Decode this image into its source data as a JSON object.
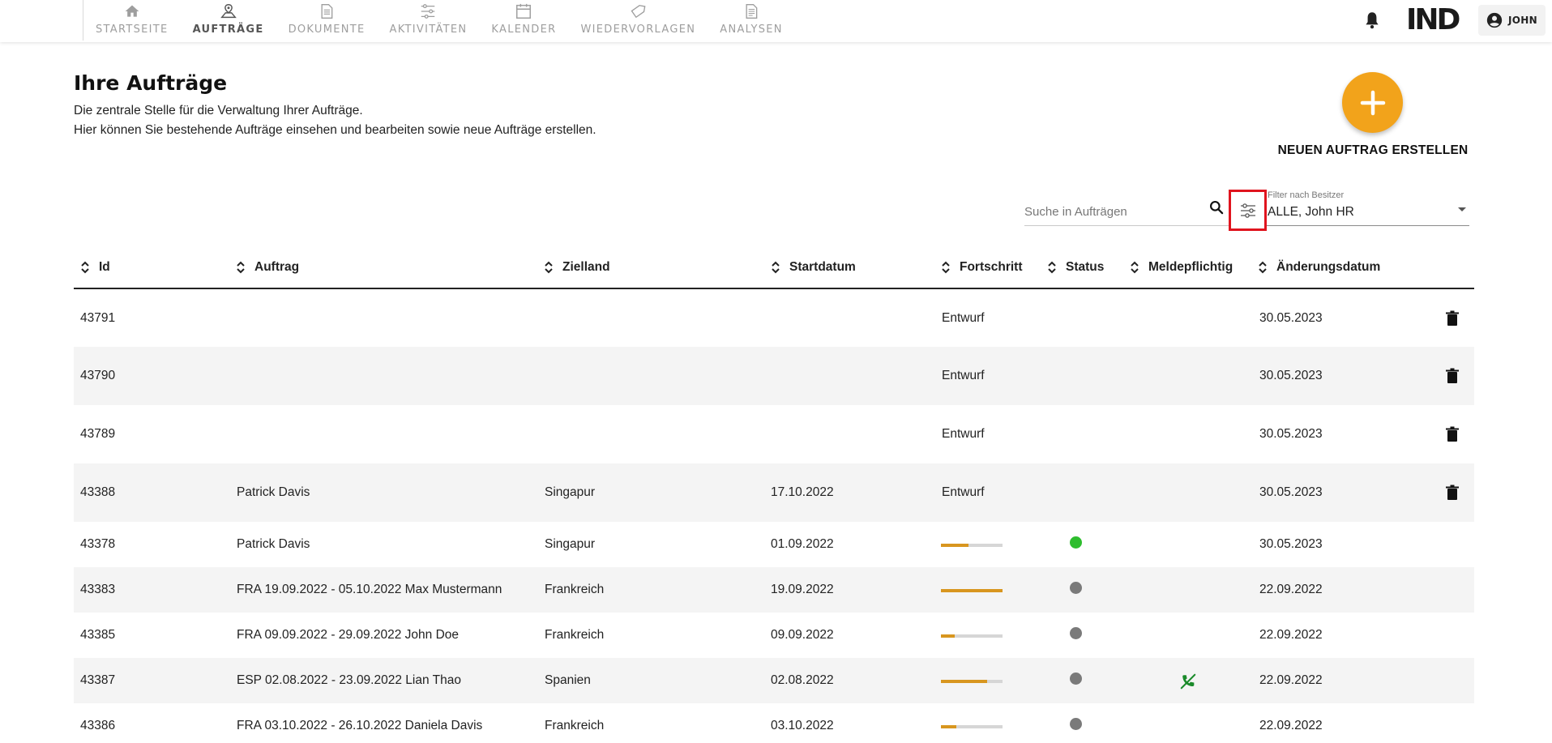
{
  "nav": {
    "items": [
      {
        "label": "STARTSEITE",
        "icon": "home-icon",
        "active": false
      },
      {
        "label": "AUFTRÄGE",
        "icon": "map-pin-icon",
        "active": true
      },
      {
        "label": "DOKUMENTE",
        "icon": "document-icon",
        "active": false
      },
      {
        "label": "AKTIVITÄTEN",
        "icon": "sliders-icon",
        "active": false
      },
      {
        "label": "KALENDER",
        "icon": "calendar-icon",
        "active": false
      },
      {
        "label": "WIEDERVORLAGEN",
        "icon": "tag-icon",
        "active": false
      },
      {
        "label": "ANALYSEN",
        "icon": "report-icon",
        "active": false
      }
    ]
  },
  "header": {
    "logo": "IND",
    "user_label": "JOHN"
  },
  "page": {
    "title": "Ihre Aufträge",
    "subtitle_line1": "Die zentrale Stelle für die Verwaltung Ihrer Aufträge.",
    "subtitle_line2": "Hier können Sie bestehende Aufträge einsehen und bearbeiten sowie neue Aufträge erstellen.",
    "new_order_label": "NEUEN AUFTRAG ERSTELLEN"
  },
  "toolbar": {
    "search_placeholder": "Suche in Aufträgen",
    "owner_filter_caption": "Filter nach Besitzer",
    "owner_filter_value": "ALLE, John HR"
  },
  "table": {
    "columns": [
      "Id",
      "Auftrag",
      "Zielland",
      "Startdatum",
      "Fortschritt",
      "Status",
      "Meldepflichtig",
      "Änderungsdatum"
    ],
    "rows": [
      {
        "id": "43791",
        "auftrag": "",
        "zielland": "",
        "startdatum": "",
        "fortschritt_text": "Entwurf",
        "progress": null,
        "status": null,
        "meldepflichtig": false,
        "aenderungsdatum": "30.05.2023",
        "deletable": true
      },
      {
        "id": "43790",
        "auftrag": "",
        "zielland": "",
        "startdatum": "",
        "fortschritt_text": "Entwurf",
        "progress": null,
        "status": null,
        "meldepflichtig": false,
        "aenderungsdatum": "30.05.2023",
        "deletable": true
      },
      {
        "id": "43789",
        "auftrag": "",
        "zielland": "",
        "startdatum": "",
        "fortschritt_text": "Entwurf",
        "progress": null,
        "status": null,
        "meldepflichtig": false,
        "aenderungsdatum": "30.05.2023",
        "deletable": true
      },
      {
        "id": "43388",
        "auftrag": "Patrick Davis",
        "zielland": "Singapur",
        "startdatum": "17.10.2022",
        "fortschritt_text": "Entwurf",
        "progress": null,
        "status": null,
        "meldepflichtig": false,
        "aenderungsdatum": "30.05.2023",
        "deletable": true
      },
      {
        "id": "43378",
        "auftrag": "Patrick Davis",
        "zielland": "Singapur",
        "startdatum": "01.09.2022",
        "fortschritt_text": "",
        "progress": 0.45,
        "status": "#2ebd2e",
        "meldepflichtig": false,
        "aenderungsdatum": "30.05.2023",
        "deletable": false
      },
      {
        "id": "43383",
        "auftrag": "FRA 19.09.2022 - 05.10.2022 Max Mustermann",
        "zielland": "Frankreich",
        "startdatum": "19.09.2022",
        "fortschritt_text": "",
        "progress": 1.0,
        "status": "#7a7a7a",
        "meldepflichtig": false,
        "aenderungsdatum": "22.09.2022",
        "deletable": false
      },
      {
        "id": "43385",
        "auftrag": "FRA 09.09.2022 - 29.09.2022 John Doe",
        "zielland": "Frankreich",
        "startdatum": "09.09.2022",
        "fortschritt_text": "",
        "progress": 0.22,
        "status": "#7a7a7a",
        "meldepflichtig": false,
        "aenderungsdatum": "22.09.2022",
        "deletable": false
      },
      {
        "id": "43387",
        "auftrag": "ESP 02.08.2022 - 23.09.2022 Lian Thao",
        "zielland": "Spanien",
        "startdatum": "02.08.2022",
        "fortschritt_text": "",
        "progress": 0.75,
        "status": "#7a7a7a",
        "meldepflichtig": true,
        "aenderungsdatum": "22.09.2022",
        "deletable": false
      },
      {
        "id": "43386",
        "auftrag": "FRA 03.10.2022 - 26.10.2022 Daniela Davis",
        "zielland": "Frankreich",
        "startdatum": "03.10.2022",
        "fortschritt_text": "",
        "progress": 0.25,
        "status": "#7a7a7a",
        "meldepflichtig": false,
        "aenderungsdatum": "22.09.2022",
        "deletable": false
      }
    ]
  },
  "colors": {
    "accent": "#f2a31b",
    "progress_fill": "#d8961f",
    "highlight_border": "#e0141e",
    "phone_icon": "#1a8a2a"
  }
}
